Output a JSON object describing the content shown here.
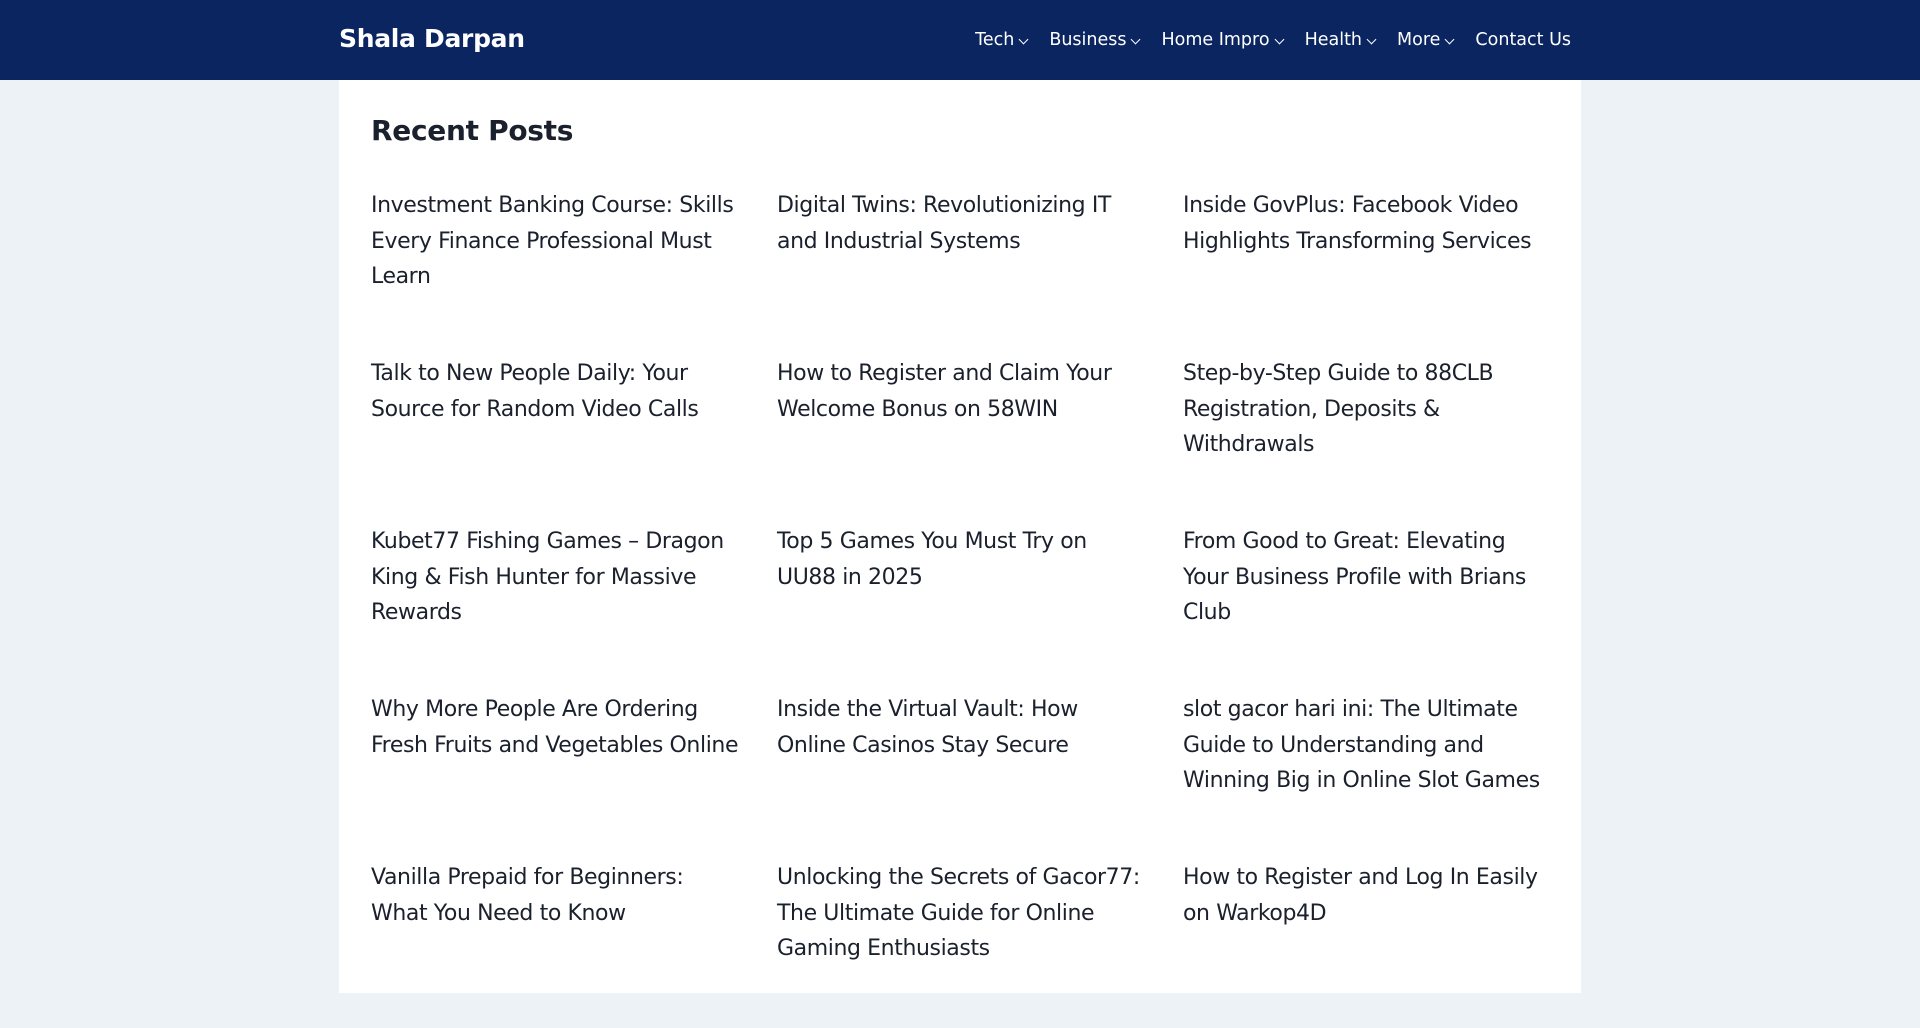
{
  "header": {
    "site_title": "Shala Darpan",
    "nav": [
      {
        "label": "Tech",
        "has_dropdown": true,
        "icon": "chevron-down-icon"
      },
      {
        "label": "Business",
        "has_dropdown": true,
        "icon": "chevron-down-icon"
      },
      {
        "label": "Home Impro",
        "has_dropdown": true,
        "icon": "chevron-down-icon"
      },
      {
        "label": "Health",
        "has_dropdown": true,
        "icon": "chevron-down-icon"
      },
      {
        "label": "More",
        "has_dropdown": true,
        "icon": "chevron-down-icon"
      },
      {
        "label": "Contact Us",
        "has_dropdown": false
      }
    ]
  },
  "main": {
    "section_title": "Recent Posts",
    "posts": [
      "Investment Banking Course: Skills Every Finance Professional Must Learn",
      "Digital Twins: Revolutionizing IT and Industrial Systems",
      "Inside GovPlus: Facebook Video Highlights Transforming Services",
      "Talk to New People Daily: Your Source for Random Video Calls",
      "How to Register and Claim Your Welcome Bonus on 58WIN",
      "Step-by-Step Guide to 88CLB Registration, Deposits & Withdrawals",
      "Kubet77 Fishing Games – Dragon King & Fish Hunter for Massive Rewards",
      "Top 5 Games You Must Try on UU88 in 2025",
      "From Good to Great: Elevating Your Business Profile with Brians Club",
      "Why More People Are Ordering Fresh Fruits and Vegetables Online",
      "Inside the Virtual Vault: How Online Casinos Stay Secure",
      "slot gacor hari ini: The Ultimate Guide to Understanding and Winning Big in Online Slot Games",
      "Vanilla Prepaid for Beginners: What You Need to Know",
      "Unlocking the Secrets of Gacor77: The Ultimate Guide for Online Gaming Enthusiasts",
      "How to Register and Log In Easily on Warkop4D"
    ]
  },
  "colors": {
    "header_bg": "#0a2560",
    "page_bg": "#edf2f7",
    "card_bg": "#ffffff",
    "text": "#1a202c",
    "header_text": "#ffffff"
  }
}
